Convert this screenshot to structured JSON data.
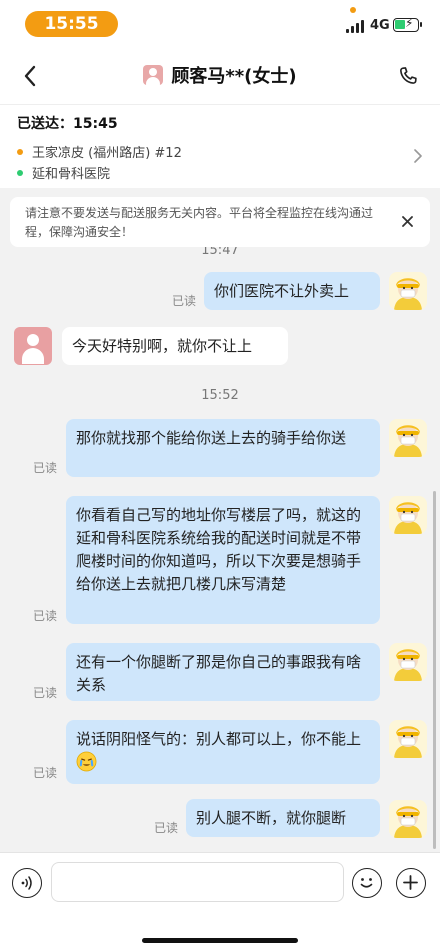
{
  "status_bar": {
    "time": "15:55",
    "network": "4G",
    "battery_percent": 40
  },
  "header": {
    "title": "顾客马**(女士)"
  },
  "order": {
    "sent_label": "已送达：15:45",
    "store": "王家凉皮 (福州路店) #12",
    "destination": "延和骨科医院",
    "colors": {
      "store_dot": "#f39c12",
      "destination_dot": "#2ecc71"
    }
  },
  "notice": {
    "text": "请注意不要发送与配送服务无关内容。平台将全程监控在线沟通过程，保障沟通安全！"
  },
  "chat": {
    "timestamps": [
      "15:47",
      "15:52"
    ],
    "read_label": "已读",
    "messages": [
      {
        "from": "me",
        "text": "你们医院不让外卖上"
      },
      {
        "from": "customer",
        "text": "今天好特别啊，就你不让上"
      },
      {
        "from": "me",
        "text": "那你就找那个能给你送上去的骑手给你送"
      },
      {
        "from": "me",
        "text": "你看看自己写的地址你写楼层了吗，就这的延和骨科医院系统给我的配送时间就是不带爬楼时间的你知道吗，所以下次要是想骑手给你送上去就把几楼几床写清楚"
      },
      {
        "from": "me",
        "text": "还有一个你腿断了那是你自己的事跟我有啥关系"
      },
      {
        "from": "me",
        "text": "说话阴阳怪气的：别人都可以上，你不能上"
      },
      {
        "from": "me",
        "text": "别人腿不断，就你腿断"
      }
    ]
  },
  "colors": {
    "accent": "#f39c12",
    "outgoing_bubble": "#cfe6fb",
    "incoming_bubble": "#ffffff",
    "background": "#f2f2f2"
  }
}
